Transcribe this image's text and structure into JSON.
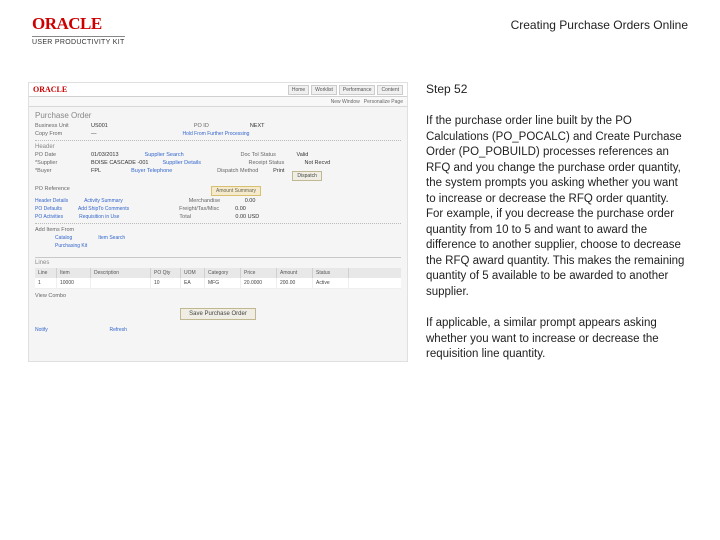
{
  "header": {
    "brand": "ORACLE",
    "brand_sub": "USER PRODUCTIVITY KIT",
    "doc_title": "Creating Purchase Orders Online"
  },
  "shot": {
    "mini_brand": "ORACLE",
    "nav": [
      "Home",
      "Worklist",
      "Performance",
      "Content"
    ],
    "sub_nav": [
      "New Window",
      "Personalize Page"
    ],
    "form_title": "Purchase Order",
    "bu_label": "Business Unit",
    "bu_val": "US001",
    "po_label": "PO ID",
    "po_val": "NEXT",
    "copy_label": "Copy From",
    "copy_val": "—",
    "holds_btn": "Hold From Further Processing",
    "header_sect": "Header",
    "po_date_label": "PO Date",
    "po_date_val": "01/03/2013",
    "supplier_label": "Supplier Search",
    "edit_status_label": "Doc Tol Status",
    "edit_status_val": "Valid",
    "supplier_id_label": "*Supplier",
    "supplier_id_val": "BOISE CASCADE -001",
    "supplier_details": "Supplier Details",
    "receipt_status_label": "Receipt Status",
    "receipt_status_val": "Not Recvd",
    "buyer_label": "*Buyer",
    "buyer_val": "FPL",
    "buyer_search": "Buyer Telephone",
    "dispatch_label": "Dispatch Method",
    "dispatch_val": "Print",
    "dispatch_btn": "Dispatch",
    "ref_label": "PO Reference",
    "amount_summary": "Amount Summary",
    "header_details": "Header Details",
    "activity_summary": "Activity Summary",
    "merch_label": "Merchandise",
    "merch_amt": "0.00",
    "po_defaults": "PO Defaults",
    "add_shipto": "Add ShipTo Comments",
    "freight_label": "Freight/Tax/Misc",
    "freight_amt": "0.00",
    "po_activities": "PO Activities",
    "req_use": "Requisition in Use",
    "total_label": "Total",
    "total_amt": "0.00 USD",
    "add_items_label": "Add Items From",
    "catalog": "Catalog",
    "item_search": "Item Search",
    "po_line_items": "Purchasing Kit",
    "lines_title": "Lines",
    "grid_cols": [
      "Line",
      "Item",
      "Description",
      "PO Qty",
      "UOM",
      "Category",
      "Price",
      "Amount",
      "Status"
    ],
    "grid_row": [
      "1",
      "10000",
      "",
      "10",
      "EA",
      "MFG",
      "20.0000",
      "200.00",
      "Active"
    ],
    "view_combo": "View Combo",
    "save_btn": "Save Purchase Order",
    "notify": "Notify",
    "refresh": "Refresh"
  },
  "side": {
    "step": "Step 52",
    "p1": "If the purchase order line built by the PO Calculations (PO_POCALC) and Create Purchase Order (PO_POBUILD) processes references an RFQ and you change the purchase order quantity, the system prompts you asking whether you want to increase or decrease the RFQ order quantity. For example, if you decrease the purchase order quantity from 10 to 5 and want to award the difference to another supplier, choose to decrease the RFQ award quantity. This makes the remaining quantity of 5 available to be awarded to another supplier.",
    "p2": "If applicable, a similar prompt appears asking whether you want to increase or decrease the requisition line quantity."
  }
}
